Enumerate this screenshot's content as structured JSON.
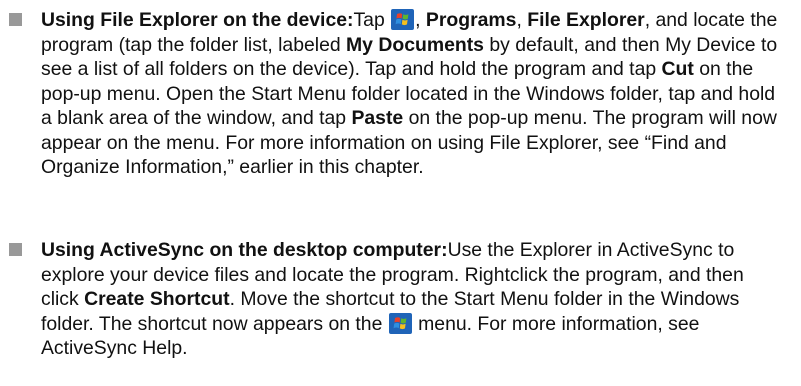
{
  "items": [
    {
      "lead": "Using File Explorer on the device:",
      "seg1": "Tap ",
      "icon": "windows-start-icon",
      "seg2": ", ",
      "b1": "Programs",
      "seg3": ", ",
      "b2": "File Explorer",
      "seg4": ", and locate the program (tap the folder list, labeled ",
      "b3": "My Documents",
      "seg5": " by default, and then My Device to see a list of all folders on the device). Tap and hold the program and tap ",
      "b4": "Cut",
      "seg6": " on the pop-up menu. Open the Start Menu folder located in the Windows folder, tap and hold a blank area of the window, and tap ",
      "b5": "Paste",
      "seg7": " on the pop-up menu. The program will now appear on the menu. For more information on using File Explorer, see “Find and Organize Information,” earlier in this chapter."
    },
    {
      "lead": "Using ActiveSync on the desktop computer:",
      "seg1": "Use the Explorer in ActiveSync to explore your device files and locate the program. Rightclick the program, and then click ",
      "b1": "Create Shortcut",
      "seg2": ". Move the shortcut to the Start Menu folder in the Windows folder. The shortcut now appears on the ",
      "icon": "windows-start-icon",
      "seg3": " menu. For more information, see ActiveSync Help."
    }
  ],
  "colors": {
    "text": "#111111",
    "bullet": "#999999",
    "icon_bg": "#1f64b8",
    "flag_red": "#e8402a",
    "flag_green": "#5fb52f",
    "flag_blue": "#2f8fe0",
    "flag_yellow": "#f4c020"
  }
}
